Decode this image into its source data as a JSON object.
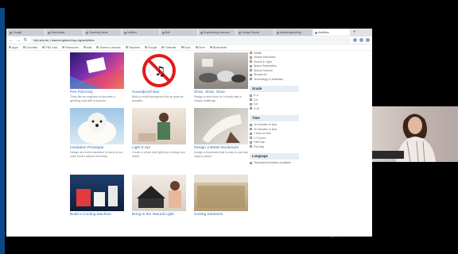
{
  "browser": {
    "tabs": [
      {
        "label": "Google"
      },
      {
        "label": "Edtechtask"
      },
      {
        "label": "Teaching Ideas"
      },
      {
        "label": "Untitled"
      },
      {
        "label": "Bell"
      },
      {
        "label": "Engineering Lessons"
      },
      {
        "label": "Design Squad"
      },
      {
        "label": "teachengineering"
      },
      {
        "label": "Activities"
      }
    ],
    "new_tab": "+",
    "url": "Not secure | teachengineering.org/activities",
    "nav_back": "←",
    "nav_forward": "→",
    "nav_reload": "↻",
    "bookmarks": [
      "Apps",
      "Favorites",
      "PBS Kids",
      "Resources",
      "Mail",
      "Science Lessons",
      "Teachers",
      "Google",
      "Calendar",
      "Docs",
      "Drive",
      "Bookmarks"
    ]
  },
  "cards": [
    {
      "title": "Pen Pal-oony",
      "desc": "Think like an engineer to decorate a greeting card with a surprise."
    },
    {
      "title": "Soundproof Box",
      "desc": "Build a small soundproof box as quiet as possible."
    },
    {
      "title": "Shoe, Shoe, Shoe",
      "desc": "Design a new shoe for a family with a unique challenge."
    },
    {
      "title": "Insulation Prototype",
      "desc": "Design and build insulation to keep an ice cube frozen without electricity."
    },
    {
      "title": "Light It Up!",
      "desc": "Create a circuit that lights up a design you made."
    },
    {
      "title": "Design a Better Bookmark",
      "desc": "Design a bookmark that is easy to use and stays in place."
    },
    {
      "title": "Build a Cooling Machine",
      "desc": ""
    },
    {
      "title": "Bring in the Natural Light",
      "desc": ""
    },
    {
      "title": "Sorting Solutions",
      "desc": ""
    }
  ],
  "sidebar": {
    "top_items": [
      "Health",
      "Simple Machines",
      "Sound & Light",
      "Space Exploration",
      "Sports Science",
      "Structures",
      "Technology & Materials"
    ],
    "grade_heading": "Grade",
    "grade_items": [
      "K-2",
      "3-5",
      "6-8",
      "9-12"
    ],
    "time_heading": "Time",
    "time_items": [
      "15 minutes or less",
      "30 minutes or less",
      "1 hour or less",
      "1-2 hours",
      "Half Day",
      "Full Day"
    ],
    "language_heading": "Language",
    "language_items": [
      "Translated Activities Available"
    ]
  },
  "footer": {
    "controls": "◂  ▸  ⏸"
  }
}
